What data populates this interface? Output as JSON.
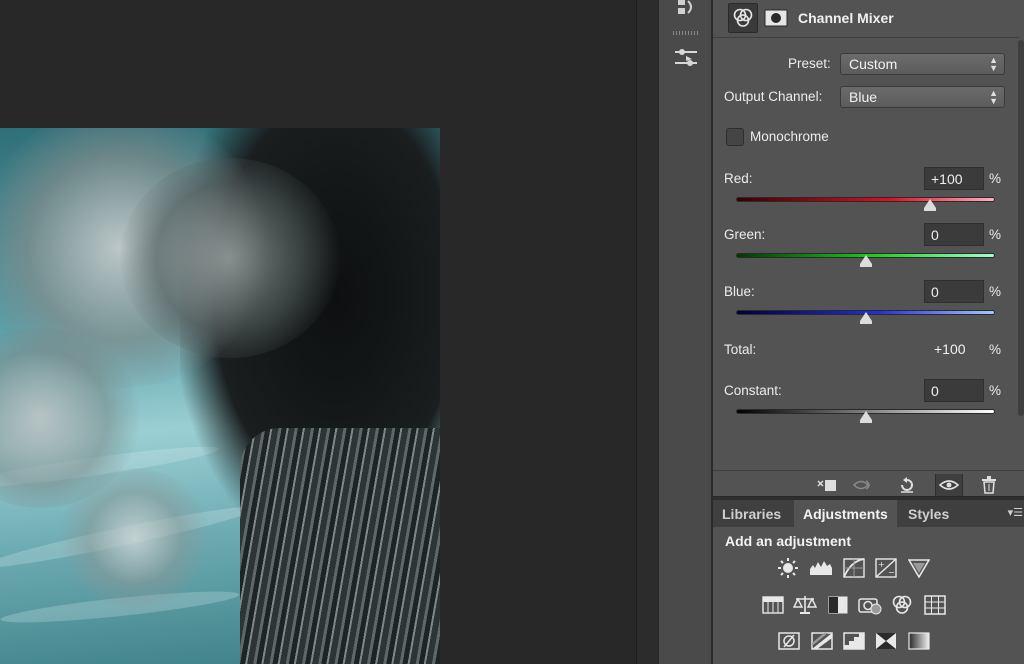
{
  "properties": {
    "title": "Channel Mixer",
    "preset_label": "Preset:",
    "preset_value": "Custom",
    "output_label": "Output Channel:",
    "output_value": "Blue",
    "monochrome_label": "Monochrome",
    "monochrome_checked": false,
    "percent_sign": "%",
    "red": {
      "label": "Red:",
      "value": "+100",
      "fraction": 0.75
    },
    "green": {
      "label": "Green:",
      "value": "0",
      "fraction": 0.5
    },
    "blue": {
      "label": "Blue:",
      "value": "0",
      "fraction": 0.5
    },
    "total": {
      "label": "Total:",
      "value": "+100"
    },
    "constant": {
      "label": "Constant:",
      "value": "0",
      "fraction": 0.5
    }
  },
  "panel_tabs": [
    {
      "label": "Libraries",
      "active": false
    },
    {
      "label": "Adjustments",
      "active": true
    },
    {
      "label": "Styles",
      "active": false
    }
  ],
  "adjustments": {
    "heading": "Add an adjustment",
    "icons": [
      "brightness-contrast-icon",
      "levels-icon",
      "curves-icon",
      "exposure-icon",
      "vibrance-icon",
      "hue-saturation-icon",
      "color-balance-icon",
      "black-white-icon",
      "photo-filter-icon",
      "channel-mixer-icon",
      "color-lookup-icon",
      "invert-icon",
      "posterize-icon",
      "threshold-icon",
      "selective-color-icon",
      "gradient-map-icon"
    ]
  },
  "colors": {
    "panel_bg": "#535353",
    "canvas_bg": "#282828",
    "field_bg": "#3b3b3b"
  }
}
